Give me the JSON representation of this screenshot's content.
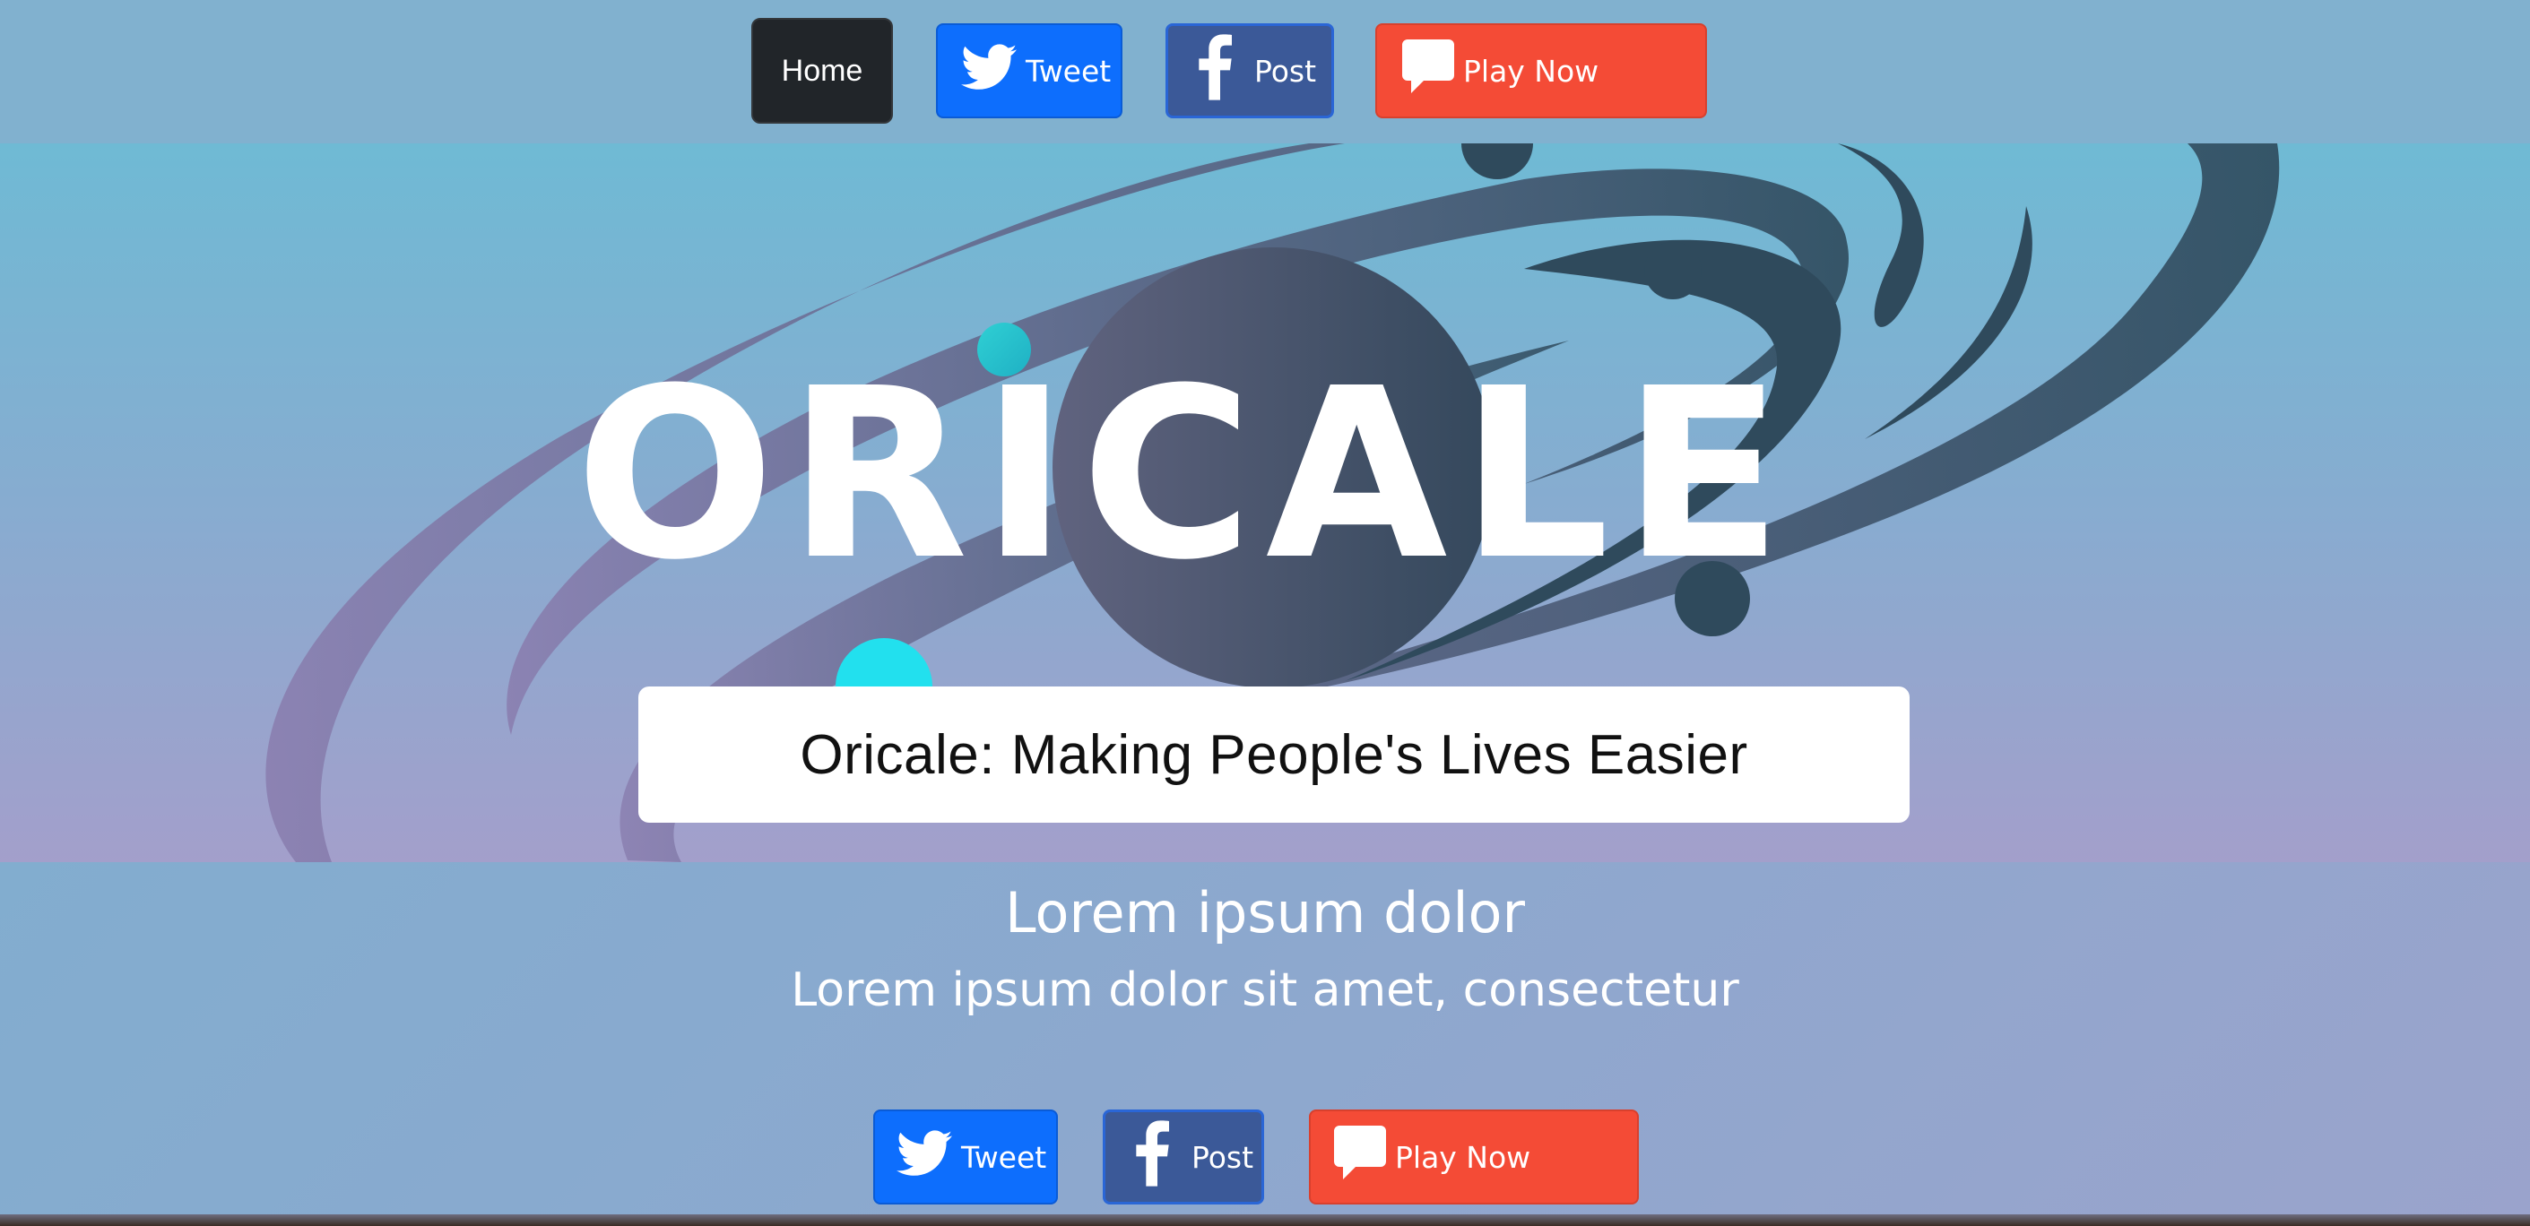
{
  "nav": {
    "home_label": "Home",
    "tweet_label": "Tweet",
    "post_label": "Post",
    "play_label": "Play Now"
  },
  "hero": {
    "logo_text": "ORICALE",
    "tagline": "Oricale: Making People's Lives Easier"
  },
  "content": {
    "heading": "Lorem ipsum dolor",
    "subheading": "Lorem ipsum dolor sit amet, consectetur"
  },
  "share": {
    "tweet_label": "Tweet",
    "post_label": "Post",
    "play_label": "Play Now"
  },
  "icons": [
    "twitter-bird-icon",
    "facebook-f-icon",
    "speech-bubble-icon",
    "planet-logo-icon"
  ],
  "colors": {
    "home": "#212529",
    "tweet": "#0d6efd",
    "post": "#3b5998",
    "play": "#f44b36",
    "planet": "#2f4a5c",
    "accent_dot": "#25c4cf"
  }
}
